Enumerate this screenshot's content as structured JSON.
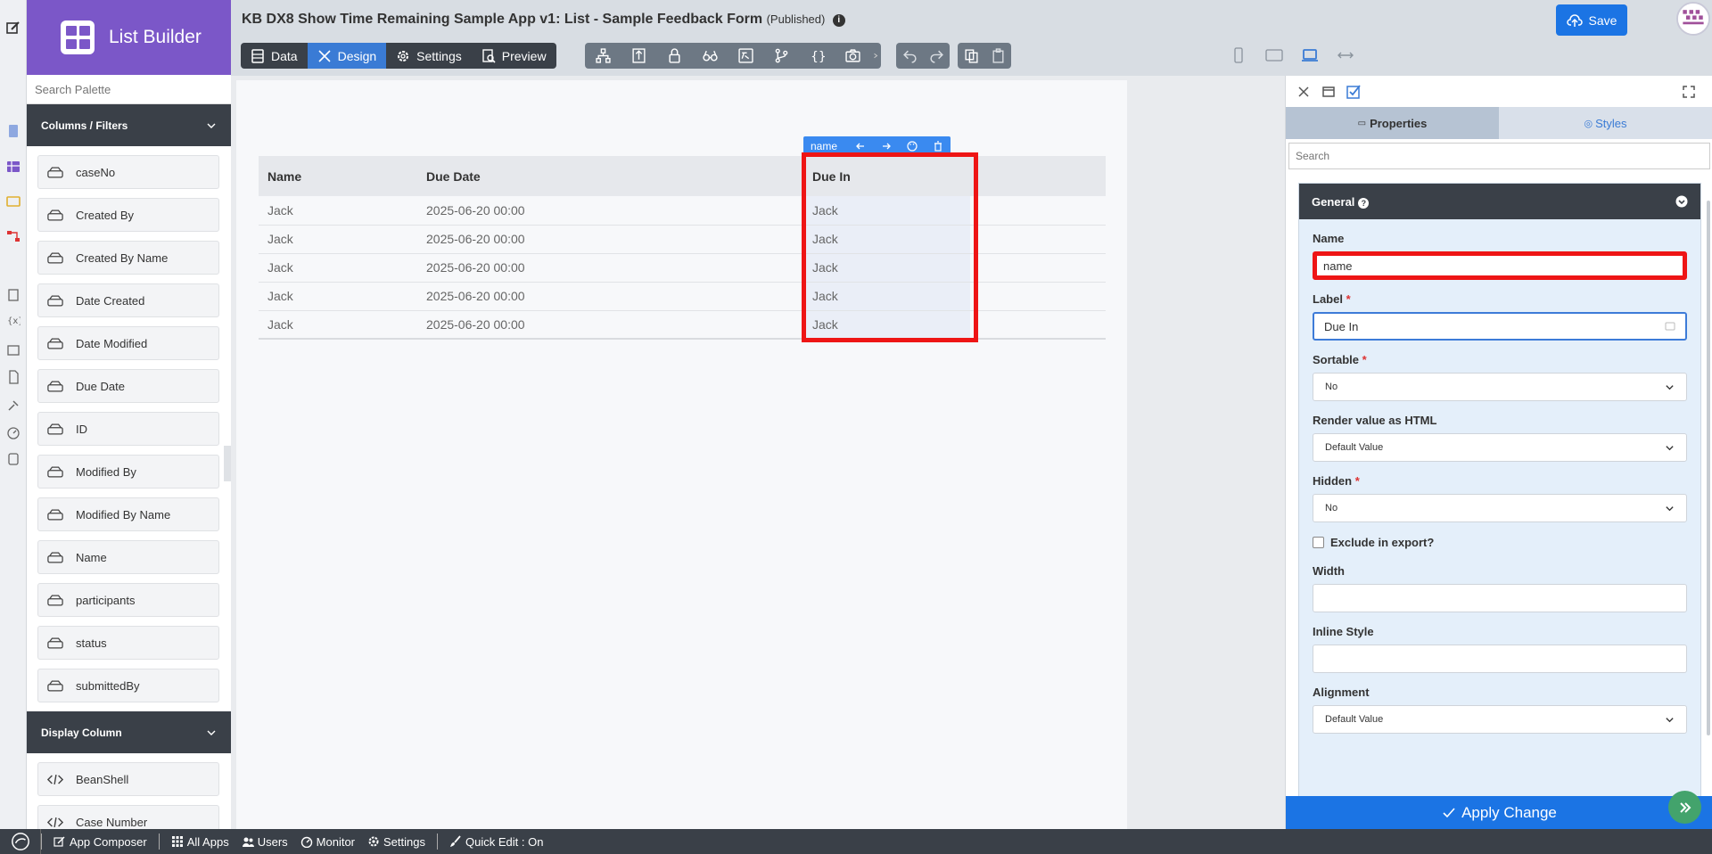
{
  "brand": {
    "title": "List Builder"
  },
  "palette": {
    "search_placeholder": "Search Palette",
    "columns_header": "Columns / Filters",
    "columns": [
      "caseNo",
      "Created By",
      "Created By Name",
      "Date Created",
      "Date Modified",
      "Due Date",
      "ID",
      "Modified By",
      "Modified By Name",
      "Name",
      "participants",
      "status",
      "submittedBy"
    ],
    "display_header": "Display Column",
    "display_items": [
      "BeanShell",
      "Case Number"
    ]
  },
  "header": {
    "title": "KB DX8 Show Time Remaining Sample App v1: List - Sample Feedback Form",
    "status": "(Published)",
    "tabs": {
      "data": "Data",
      "design": "Design",
      "settings": "Settings",
      "preview": "Preview"
    },
    "save_label": "Save"
  },
  "list": {
    "columns": [
      "Name",
      "Due Date",
      "Due In"
    ],
    "rows": [
      [
        "Jack",
        "2025-06-20 00:00",
        "Jack"
      ],
      [
        "Jack",
        "2025-06-20 00:00",
        "Jack"
      ],
      [
        "Jack",
        "2025-06-20 00:00",
        "Jack"
      ],
      [
        "Jack",
        "2025-06-20 00:00",
        "Jack"
      ],
      [
        "Jack",
        "2025-06-20 00:00",
        "Jack"
      ]
    ],
    "selected_toolbar_label": "name"
  },
  "properties": {
    "tab_properties": "Properties",
    "tab_styles": "Styles",
    "search_placeholder": "Search",
    "section_title": "General",
    "name_label": "Name",
    "name_value": "name",
    "label_label": "Label",
    "label_value": "Due In",
    "sortable_label": "Sortable",
    "sortable_value": "No",
    "render_html_label": "Render value as HTML",
    "render_html_value": "Default Value",
    "hidden_label": "Hidden",
    "hidden_value": "No",
    "exclude_label": "Exclude in export?",
    "width_label": "Width",
    "width_value": "",
    "inline_style_label": "Inline Style",
    "inline_style_value": "",
    "alignment_label": "Alignment",
    "alignment_value": "Default Value",
    "apply_label": "Apply Change"
  },
  "bottombar": {
    "app_composer": "App Composer",
    "all_apps": "All Apps",
    "users": "Users",
    "monitor": "Monitor",
    "settings": "Settings",
    "quick_edit": "Quick Edit : On"
  },
  "colors": {
    "brand": "#7b57c8",
    "accent": "#1b74e4",
    "dark": "#3a4048",
    "highlight": "#ee1515"
  }
}
